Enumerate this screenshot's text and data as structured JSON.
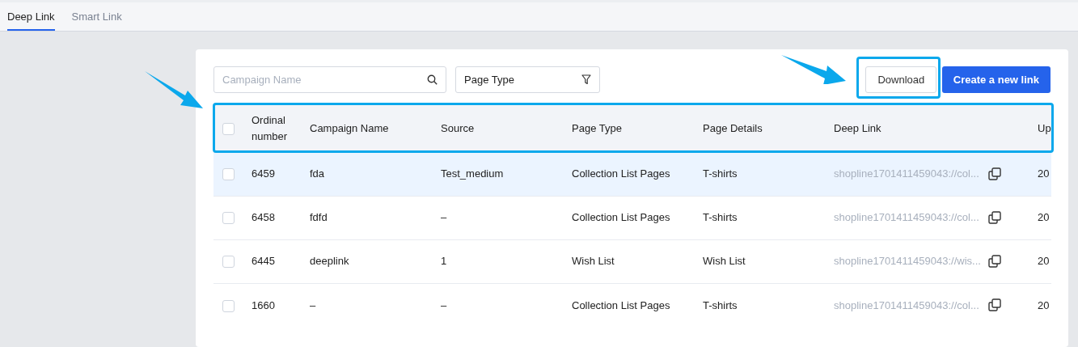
{
  "tabs": [
    {
      "label": "Deep Link",
      "selected": true
    },
    {
      "label": "Smart Link",
      "selected": false
    }
  ],
  "toolbar": {
    "search": {
      "placeholder": "Campaign Name"
    },
    "filter": {
      "value": "Page Type"
    },
    "buttons": [
      {
        "label": "Download",
        "kind": "secondary"
      },
      {
        "label": "Create a new link",
        "kind": "primary"
      }
    ]
  },
  "table": {
    "select_all": {
      "checked": false
    },
    "columns": [
      "Ordinal number",
      "Campaign Name",
      "Source",
      "Page Type",
      "Page Details",
      "Deep Link",
      "Up"
    ],
    "rows": [
      {
        "selected": true,
        "checked": false,
        "cells": [
          "6459",
          "fda",
          "Test_medium",
          "Collection List Pages",
          "T-shirts",
          "shopline1701411459043://col...",
          "20"
        ]
      },
      {
        "selected": false,
        "checked": false,
        "cells": [
          "6458",
          "fdfd",
          "–",
          "Collection List Pages",
          "T-shirts",
          "shopline1701411459043://col...",
          "20"
        ]
      },
      {
        "selected": false,
        "checked": false,
        "cells": [
          "6445",
          "deeplink",
          "1",
          "Wish List",
          "Wish List",
          "shopline1701411459043://wis...",
          "20"
        ]
      },
      {
        "selected": false,
        "checked": false,
        "cells": [
          "1660",
          "–",
          "–",
          "Collection List Pages",
          "T-shirts",
          "shopline1701411459043://col...",
          "20"
        ]
      }
    ]
  }
}
